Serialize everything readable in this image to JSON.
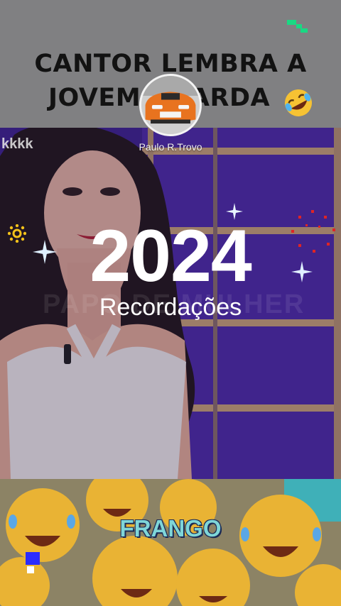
{
  "caption": {
    "line1": "CANTOR LEMBRA A",
    "line2": "JOVEM GUARDA",
    "emoji": "rolling-on-floor-laughing-emoji"
  },
  "profile": {
    "name": "Paulo R.Trovo",
    "avatar_plate": "TOTAL",
    "avatar_color": "#e8731f"
  },
  "video": {
    "overlay_text": "kkkk",
    "watermark": "PAPO DE MULHER"
  },
  "recap": {
    "year": "2024",
    "subtitle": "Recordações"
  },
  "bottom": {
    "label": "FRANGO"
  },
  "colors": {
    "brand_green": "#19d983",
    "video_purple": "#3c1f8e",
    "frango_text": "#7fd6d8",
    "pixel_blue": "#2b2bff"
  }
}
